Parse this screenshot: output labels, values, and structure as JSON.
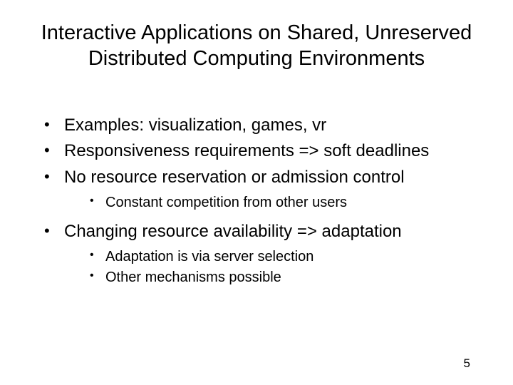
{
  "title": "Interactive Applications on Shared, Unreserved Distributed Computing Environments",
  "bullets": [
    {
      "text": "Examples: visualization, games, vr",
      "sub": []
    },
    {
      "text": "Responsiveness requirements => soft deadlines",
      "sub": []
    },
    {
      "text": "No resource reservation or admission control",
      "sub": [
        "Constant competition from other users"
      ]
    },
    {
      "text": "Changing resource availability => adaptation",
      "sub": [
        "Adaptation is via server selection",
        "Other mechanisms possible"
      ]
    }
  ],
  "page_number": "5"
}
